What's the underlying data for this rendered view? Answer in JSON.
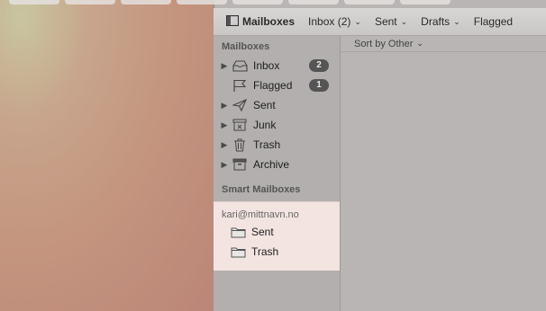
{
  "favorites_bar": {
    "mailboxes_label": "Mailboxes",
    "inbox_label": "Inbox (2)",
    "sent_label": "Sent",
    "drafts_label": "Drafts",
    "flagged_label": "Flagged"
  },
  "sidebar": {
    "mailboxes_header": "Mailboxes",
    "items": [
      {
        "label": "Inbox",
        "icon": "inbox-tray-icon",
        "badge": "2"
      },
      {
        "label": "Flagged",
        "icon": "flag-icon",
        "badge": "1"
      },
      {
        "label": "Sent",
        "icon": "paper-plane-icon"
      },
      {
        "label": "Junk",
        "icon": "junk-box-icon"
      },
      {
        "label": "Trash",
        "icon": "trash-can-icon"
      },
      {
        "label": "Archive",
        "icon": "archive-box-icon"
      }
    ],
    "smart_header": "Smart Mailboxes",
    "account": {
      "name": "kari@mittnavn.no",
      "folders": [
        {
          "label": "Sent",
          "icon": "folder-icon"
        },
        {
          "label": "Trash",
          "icon": "folder-icon"
        }
      ]
    }
  },
  "message_list": {
    "sort_label": "Sort by Other"
  },
  "colors": {
    "sidebar_bg": "#b2afae",
    "account_highlight": "#f3e4e1",
    "badge_bg": "#555555"
  }
}
